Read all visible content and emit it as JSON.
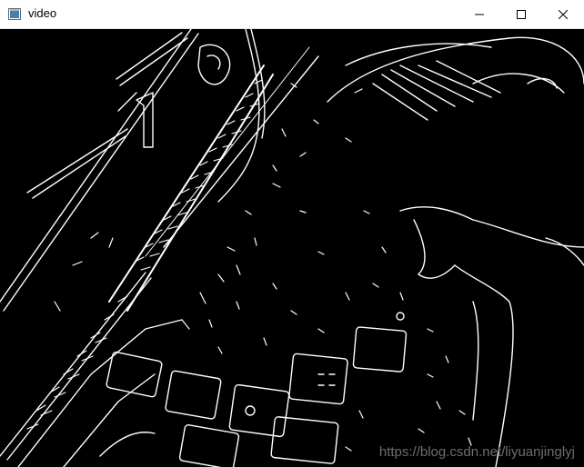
{
  "window": {
    "title": "video",
    "icon": "opencv-window-icon",
    "controls": [
      "minimize-icon",
      "maximize-icon",
      "close-icon"
    ]
  },
  "image": {
    "description_icon": "canny-edge-keyboard-frame"
  },
  "watermark": {
    "text": "https://blog.csdn.net/liyuanjinglyj"
  }
}
